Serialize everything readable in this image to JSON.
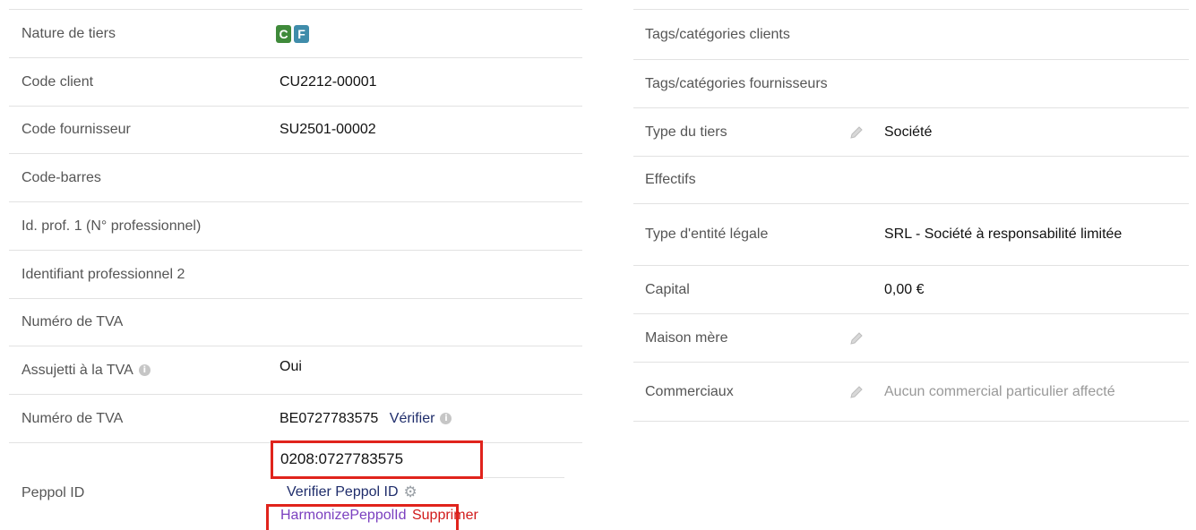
{
  "left": {
    "rows": [
      {
        "label": "Nature de tiers",
        "value": ""
      },
      {
        "label": "Code client",
        "value": "CU2212-00001"
      },
      {
        "label": "Code fournisseur",
        "value": "SU2501-00002"
      },
      {
        "label": "Code-barres",
        "value": ""
      },
      {
        "label": "Id. prof. 1 (N° professionnel)",
        "value": ""
      },
      {
        "label": "Identifiant professionnel 2",
        "value": ""
      },
      {
        "label": "Numéro de TVA",
        "value": ""
      },
      {
        "label": "Assujetti à la TVA",
        "value": "Oui"
      },
      {
        "label": "Numéro de TVA",
        "value": "BE0727783575"
      },
      {
        "label": "Peppol ID",
        "value": "0208:0727783575"
      }
    ],
    "badges": {
      "customer": "C",
      "supplier": "F"
    },
    "verify_link": "Vérifier",
    "peppol_verify_link": "Verifier Peppol ID",
    "harmonize_link": "HarmonizePeppolId",
    "delete_link": "Supprimer"
  },
  "right": {
    "rows": [
      {
        "label": "Tags/catégories clients",
        "value": ""
      },
      {
        "label": "Tags/catégories fournisseurs",
        "value": ""
      },
      {
        "label": "Type du tiers",
        "value": "Société"
      },
      {
        "label": "Effectifs",
        "value": ""
      },
      {
        "label": "Type d'entité légale",
        "value": "SRL - Société à responsabilité limitée"
      },
      {
        "label": "Capital",
        "value": "0,00 €"
      },
      {
        "label": "Maison mère",
        "value": ""
      },
      {
        "label": "Commerciaux",
        "value": "Aucun commercial particulier affecté"
      }
    ]
  },
  "colors": {
    "highlight": "#e0231c",
    "badge_customer": "#3f8a3a",
    "badge_supplier": "#3f8caa",
    "link": "#1f2d6b"
  },
  "icons": {
    "info": "info-icon",
    "edit": "pencil-icon",
    "settings": "gear-icon"
  }
}
